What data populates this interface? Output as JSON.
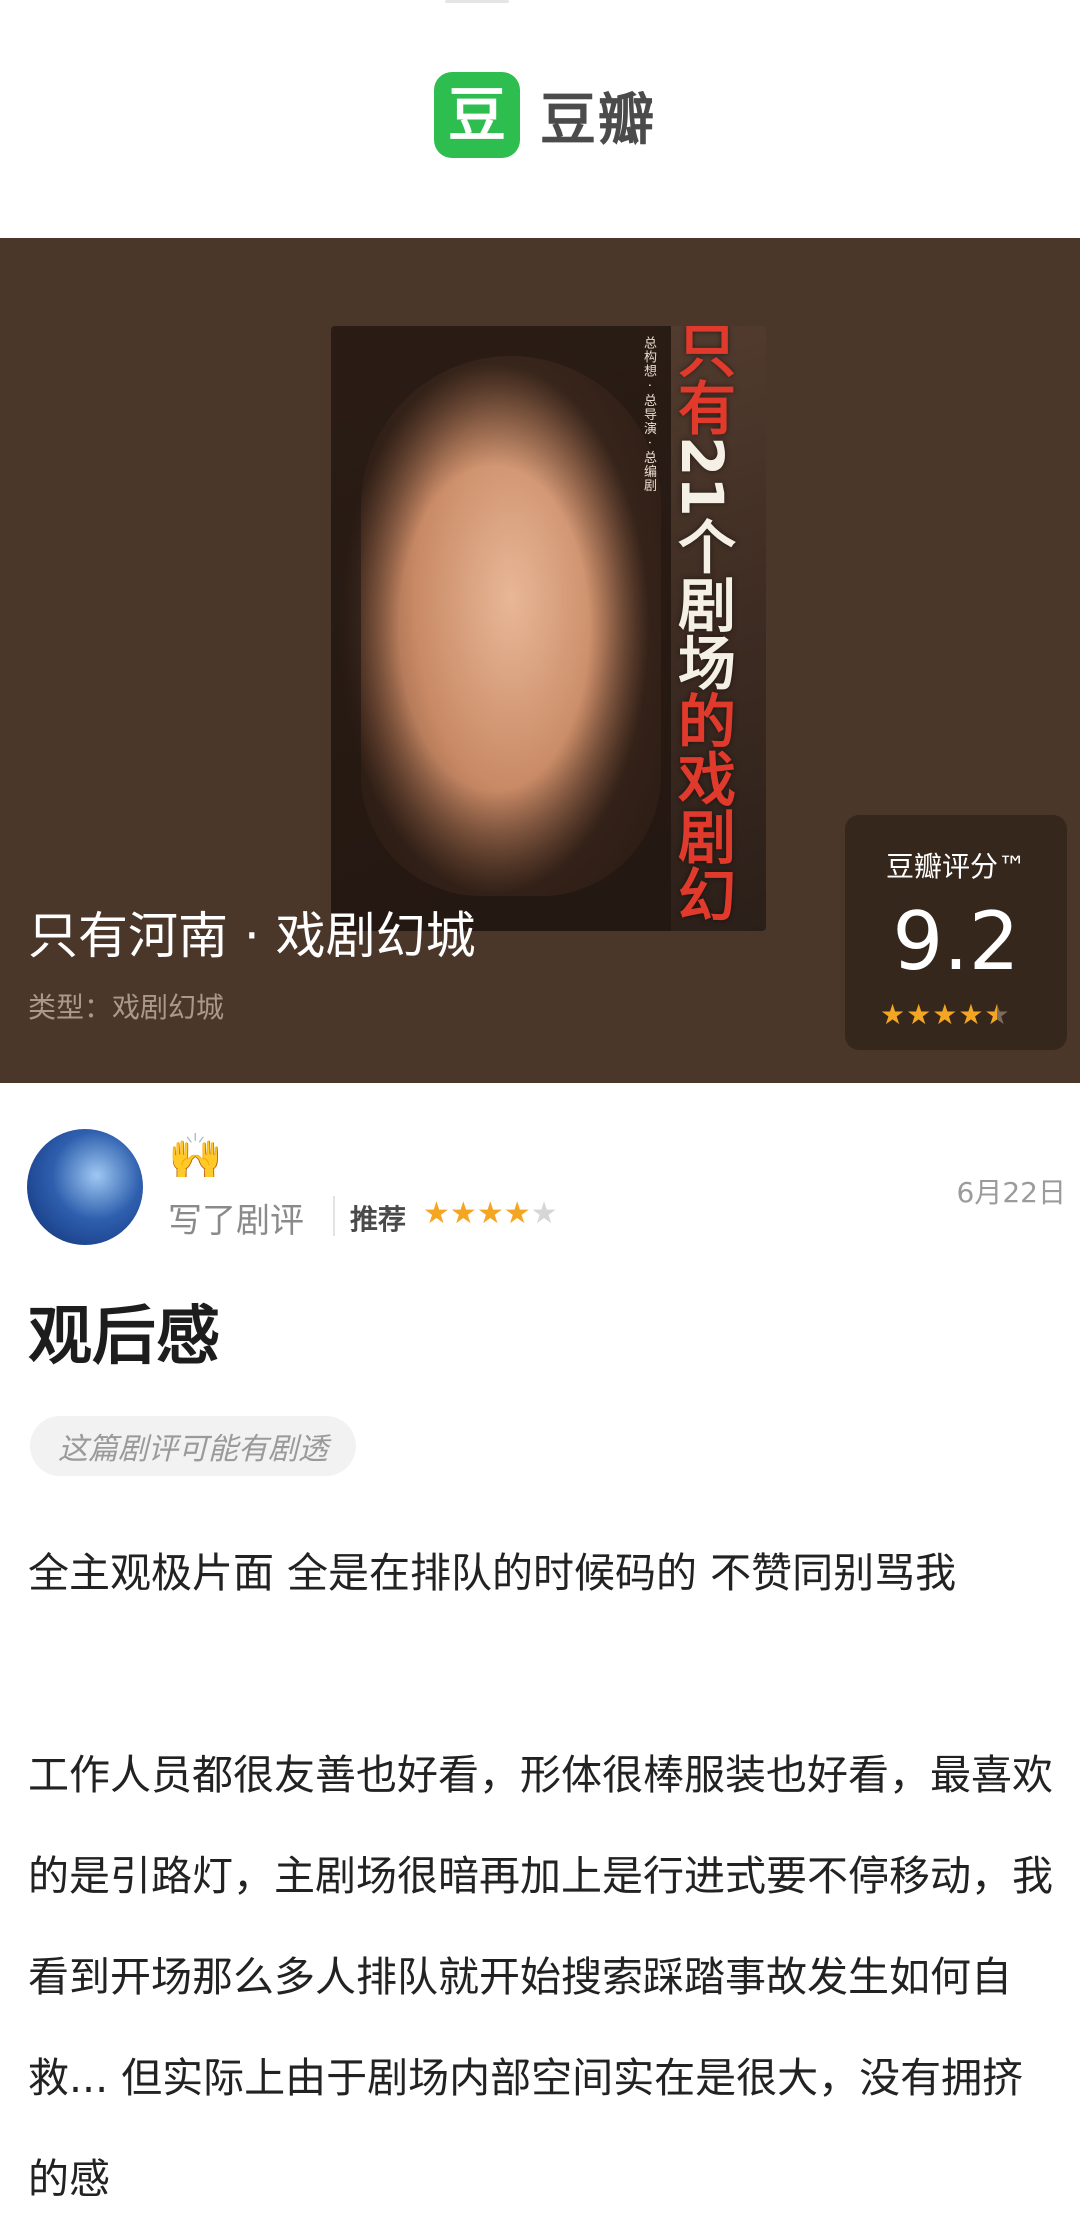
{
  "header": {
    "logo_char": "豆",
    "logo_text": "豆瓣"
  },
  "poster": {
    "title_lines": [
      "只有",
      "21",
      "个",
      "剧场",
      "的戏剧幻"
    ],
    "credits": "总构想 · 总导演 · 总编剧"
  },
  "show": {
    "title": "只有河南 · 戏剧幻城",
    "type_label": "类型：",
    "type_value": "戏剧幻城"
  },
  "rating": {
    "label": "豆瓣评分™",
    "score": "9.2",
    "stars": 4.5
  },
  "review": {
    "emoji": "🙌",
    "action": "写了剧评",
    "recommend": "推荐",
    "stars": 4,
    "date": "6月22日",
    "title": "观后感",
    "spoiler": "这篇剧评可能有剧透",
    "paragraphs": [
      "全主观极片面 全是在排队的时候码的 不赞同别骂我",
      "工作人员都很友善也好看，形体很棒服装也好看，最喜欢的是引路灯，主剧场很暗再加上是行进式要不停移动，我看到开场那么多人排队就开始搜索踩踏事故发生如何自救... 但实际上由于剧场内部空间实在是很大，没有拥挤的感"
    ]
  },
  "colors": {
    "brand_green": "#2dbe4f",
    "hero_bg": "#4b3729",
    "star": "#f4a623"
  }
}
